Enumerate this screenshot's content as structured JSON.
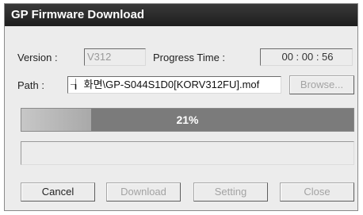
{
  "window": {
    "title": "GP Firmware Download"
  },
  "form": {
    "version_label": "Version :",
    "version_value": "V312",
    "progress_time_label": "Progress Time :",
    "progress_time_value": "00 : 00 : 56",
    "path_label": "Path :",
    "path_value": "┧ 화면\\GP-S044S1D0[KORV312FU].mof"
  },
  "progress": {
    "percent": 21,
    "text": "21%"
  },
  "status": {
    "text": ""
  },
  "buttons": {
    "browse": "Browse...",
    "cancel": "Cancel",
    "download": "Download",
    "setting": "Setting",
    "close": "Close"
  }
}
